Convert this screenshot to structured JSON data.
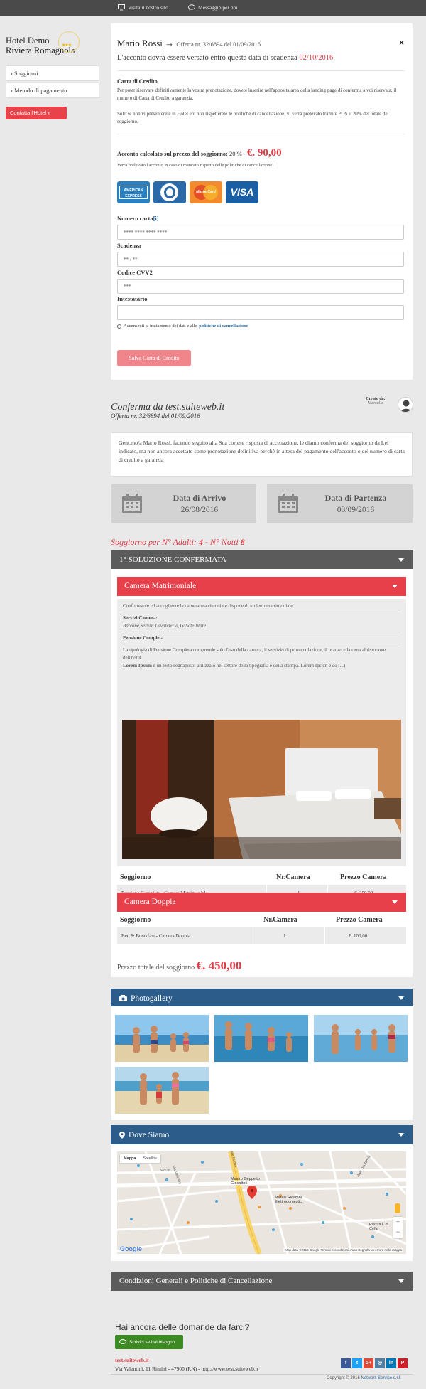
{
  "topbar": {
    "visit": "Visita il nostro sito",
    "message": "Messaggio per noi"
  },
  "logo": {
    "line1": "Hotel Demo",
    "line2": "Riviera Romagnola",
    "stars": "★★★"
  },
  "sidebar": {
    "items": [
      {
        "label": "› Soggiorni"
      },
      {
        "label": "› Metodo di pagamento"
      }
    ],
    "contact": "Contatta l'Hotel »"
  },
  "modal": {
    "close": "×",
    "name": "Mario Rossi",
    "arrow": "→",
    "offer": "Offerta nr. 32/6894 del 01/09/2016",
    "due_text": "L'acconto dovrà essere versato entro questa data di scadenza",
    "due_date": "02/10/2016",
    "cc_heading": "Carta di Credito",
    "cc_p1": "Per poter riservare definitivamente la vostra prenotazione, dovete inserire nell'apposita area della landing page di conferma a voi riservata, il numero di Carta di Credito a garanzia.",
    "cc_p2": "Solo se non vi presenterete in Hotel e/o non rispetterete le politiche di cancellazione, vi verrà prelevato tramite POS il 20% del totale del soggiorno.",
    "acc_label": "Acconto calcolato sul prezzo del soggiorno:",
    "acc_pct": "20 % -",
    "acc_amount": "€. 90,00",
    "acc_note": "Verrà prelevato l'acconto in caso di mancato rispetto delle politiche di cancellazione!",
    "cards": {
      "amex": "AMERICAN EXPRESS",
      "mastercard": "MasterCard",
      "visa": "VISA"
    },
    "fields": {
      "number_label": "Numero carta",
      "number_info": "[i]",
      "number_placeholder": "**** **** **** ****",
      "expiry_label": "Scadenza",
      "expiry_placeholder": "** / **",
      "cvv_label": "Codice CVV2",
      "cvv_placeholder": "***",
      "holder_label": "Intestatario",
      "holder_placeholder": ""
    },
    "consent_text": "Acconsenti al trattamento dei dati e alle",
    "consent_link": "politiche di cancellazione",
    "save": "Salva Carta di Credito"
  },
  "confirmation": {
    "title": "Conferma da test.suiteweb.it",
    "subtitle": "Offerta nr. 32/6894 del 01/09/2016",
    "created_label": "Creato da:",
    "created_name": "Marcello",
    "intro": "Gent.mo/a Mario Rossi, facendo seguito alla Sua cortese risposta di accettazione, le diamo conferma del soggiorno da Lei indicato, ma non ancora accettato come prenotazione definitiva perchè in attesa del pagamento dell'acconto o del numero di carta di credito a garanzia",
    "arrival_label": "Data di Arrivo",
    "arrival_date": "26/08/2016",
    "departure_label": "Data di Partenza",
    "departure_date": "03/09/2016",
    "stay_prefix": "Soggiorno per N° Adulti:",
    "stay_adults": "4",
    "stay_mid": "- N° Notti",
    "stay_nights": "8"
  },
  "solution": {
    "header": "1° SOLUZIONE CONFERMATA",
    "room1": {
      "name": "Camera Matrimoniale",
      "desc": "Confortevole ed accogliente la camera matrimoniale dispone di un letto matrimoniale",
      "services_label": "Servizi Camera:",
      "services": "Balcone,Servizi Lavanderia,Tv Satellitare",
      "board_label": "Pensione Completa",
      "board_desc": "La tipologia di Pensione Completa comprende solo l'uso della camera, il servizio di prima colazione, il pranzo e la cena al ristorante dell'hotel",
      "lorem_bold": "Lorem Ipsum",
      "lorem": "è un testo segnaposto utilizzato nel settore della tipografia e della stampa. Lorem Ipsum è co (...)",
      "col1": "Soggiorno",
      "col2": "Nr.Camera",
      "col3": "Prezzo Camera",
      "row_type": "Pensione Completa - Camera Matrimoniale",
      "row_qty": "1",
      "row_price": "€. 350,00"
    },
    "room2": {
      "name": "Camera Doppia",
      "col1": "Soggiorno",
      "col2": "Nr.Camera",
      "col3": "Prezzo Camera",
      "row_type": "Bed & Breakfast - Camera Doppia",
      "row_qty": "1",
      "row_price": "€. 100,00"
    },
    "total_label": "Prezzo totale del soggiorno",
    "total_amount": "€. 450,00"
  },
  "gallery": {
    "title": "Photogallery"
  },
  "location": {
    "title": "Dove Siamo",
    "map_tab": "Mappa",
    "sat_tab": "Satellite",
    "poi1": "Mastro Geppetto Giocattoli",
    "poi2": "Maresi Ricambi Elettrodomestici",
    "poi3": "Piazza I. di Cefa",
    "road1": "Viale Nuova",
    "road2": "Via Valentini",
    "road3": "SP136",
    "road4": "Viale Dardanelli",
    "google": "Google",
    "attribution": "Map data ©2016 Google   Termini e condizioni d'uso   Segnala un errore nella mappa"
  },
  "conditions": {
    "title": "Condizioni Generali e Politiche di Cancellazione"
  },
  "footer": {
    "question": "Hai ancora delle domande da farci?",
    "write": "Scrivici se hai bisogno",
    "site": "test.suiteweb.it",
    "address": "Via Valentini, 11 Rimini - 47900 (RN) - http://www.test.suiteweb.it",
    "copyright": "Copyright © 2016",
    "brand": "Network Service s.r.l.",
    "social": [
      "f",
      "t",
      "G+",
      "◎",
      "in",
      "P"
    ]
  },
  "colors": {
    "accent_red": "#e8404a",
    "dark_bar": "#5b5b5b",
    "blue_bar": "#2c5d8a",
    "green": "#3d8a22"
  }
}
